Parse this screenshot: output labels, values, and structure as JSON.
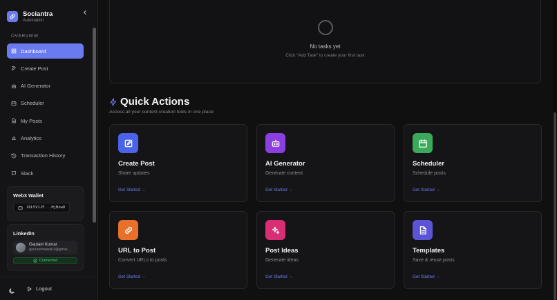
{
  "brand": {
    "name": "Sociantra",
    "subtitle": "Automation",
    "logo_icon": "link-icon",
    "accent": "#6a7bf0"
  },
  "sidebar": {
    "section_label": "OVERVIEW",
    "items": [
      {
        "label": "Dashboard",
        "icon": "grid-icon",
        "active": true
      },
      {
        "label": "Create Post",
        "icon": "edit-icon"
      },
      {
        "label": "AI Generator",
        "icon": "bot-icon"
      },
      {
        "label": "Scheduler",
        "icon": "calendar-icon"
      },
      {
        "label": "My Posts",
        "icon": "document-icon"
      },
      {
        "label": "Analytics",
        "icon": "bar-chart-icon"
      },
      {
        "label": "Transaction History",
        "icon": "history-icon"
      },
      {
        "label": "Slack",
        "icon": "chat-icon"
      }
    ],
    "wallet": {
      "title": "Web3 Wallet",
      "address": "16L5V1JF...HjBowD"
    },
    "linkedin": {
      "title": "LinkedIn",
      "user_name": "Gautam Kumar",
      "user_email": "gautammanak1@gmai...",
      "status": "Connected",
      "status_color": "#4fd07a"
    },
    "footer": {
      "logout_label": "Logout"
    }
  },
  "tasks": {
    "title": "No tasks yet",
    "subtitle": "Click “Add Task” to create your first task"
  },
  "quick_actions": {
    "title": "Quick Actions",
    "subtitle": "Access all your content creation tools in one place",
    "cards": [
      {
        "name": "Create Post",
        "desc": "Share updates",
        "link": "Get Started →",
        "icon": "edit-icon",
        "color": "#4a63e8"
      },
      {
        "name": "AI Generator",
        "desc": "Generate content",
        "link": "Get Started →",
        "icon": "bot-icon",
        "color": "#8b3fe0"
      },
      {
        "name": "Scheduler",
        "desc": "Schedule posts",
        "link": "Get Started →",
        "icon": "calendar-icon",
        "color": "#3aa95a"
      },
      {
        "name": "URL to Post",
        "desc": "Convert URLs to posts",
        "link": "Get Started →",
        "icon": "link-icon",
        "color": "#e8702a"
      },
      {
        "name": "Post Ideas",
        "desc": "Generate ideas",
        "link": "Get Started →",
        "icon": "sparkles-icon",
        "color": "#d92e74"
      },
      {
        "name": "Templates",
        "desc": "Save & reuse posts",
        "link": "Get Started →",
        "icon": "template-icon",
        "color": "#5b55d6"
      }
    ]
  }
}
